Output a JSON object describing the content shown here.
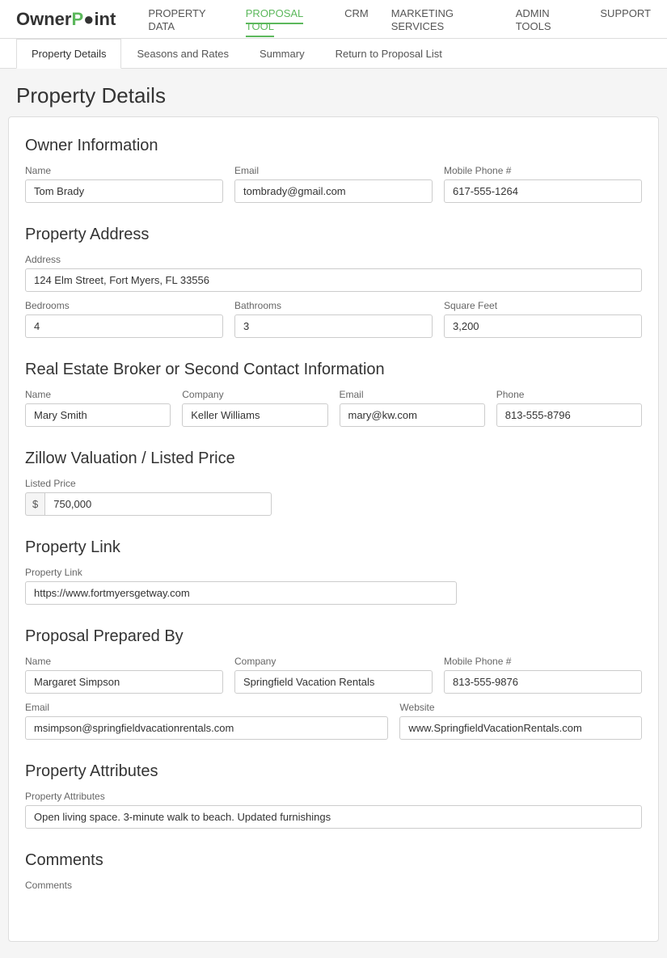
{
  "logo": {
    "text_before": "OwnerP",
    "dot": "●",
    "text_after": "int"
  },
  "nav": {
    "links": [
      {
        "label": "PROPERTY DATA",
        "active": false
      },
      {
        "label": "PROPOSAL TOOL",
        "active": true
      },
      {
        "label": "CRM",
        "active": false
      },
      {
        "label": "MARKETING SERVICES",
        "active": false
      },
      {
        "label": "ADMIN TOOLS",
        "active": false
      },
      {
        "label": "SUPPORT",
        "active": false
      }
    ]
  },
  "tabs": [
    {
      "label": "Property Details",
      "active": true
    },
    {
      "label": "Seasons and Rates",
      "active": false
    },
    {
      "label": "Summary",
      "active": false
    },
    {
      "label": "Return to Proposal List",
      "active": false
    }
  ],
  "page_title": "Property Details",
  "sections": {
    "owner_info": {
      "title": "Owner Information",
      "name_label": "Name",
      "name_value": "Tom Brady",
      "email_label": "Email",
      "email_value": "tombrady@gmail.com",
      "phone_label": "Mobile Phone #",
      "phone_value": "617-555-1264"
    },
    "property_address": {
      "title": "Property Address",
      "address_label": "Address",
      "address_value": "124 Elm Street, Fort Myers, FL 33556",
      "bedrooms_label": "Bedrooms",
      "bedrooms_value": "4",
      "bathrooms_label": "Bathrooms",
      "bathrooms_value": "3",
      "sqft_label": "Square Feet",
      "sqft_value": "3,200"
    },
    "broker": {
      "title": "Real Estate Broker or Second Contact Information",
      "name_label": "Name",
      "name_value": "Mary Smith",
      "company_label": "Company",
      "company_value": "Keller Williams",
      "email_label": "Email",
      "email_value": "mary@kw.com",
      "phone_label": "Phone",
      "phone_value": "813-555-8796"
    },
    "zillow": {
      "title": "Zillow Valuation / Listed Price",
      "price_label": "Listed Price",
      "price_prefix": "$",
      "price_value": "750,000"
    },
    "property_link": {
      "title": "Property Link",
      "link_label": "Property Link",
      "link_value": "https://www.fortmyersgetway.com"
    },
    "prepared_by": {
      "title": "Proposal Prepared By",
      "name_label": "Name",
      "name_value": "Margaret Simpson",
      "company_label": "Company",
      "company_value": "Springfield Vacation Rentals",
      "phone_label": "Mobile Phone #",
      "phone_value": "813-555-9876",
      "email_label": "Email",
      "email_value": "msimpson@springfieldvacationrentals.com",
      "website_label": "Website",
      "website_value": "www.SpringfieldVacationRentals.com"
    },
    "attributes": {
      "title": "Property Attributes",
      "attr_label": "Property Attributes",
      "attr_value": "Open living space. 3-minute walk to beach. Updated furnishings"
    },
    "comments": {
      "title": "Comments",
      "comments_label": "Comments"
    }
  }
}
